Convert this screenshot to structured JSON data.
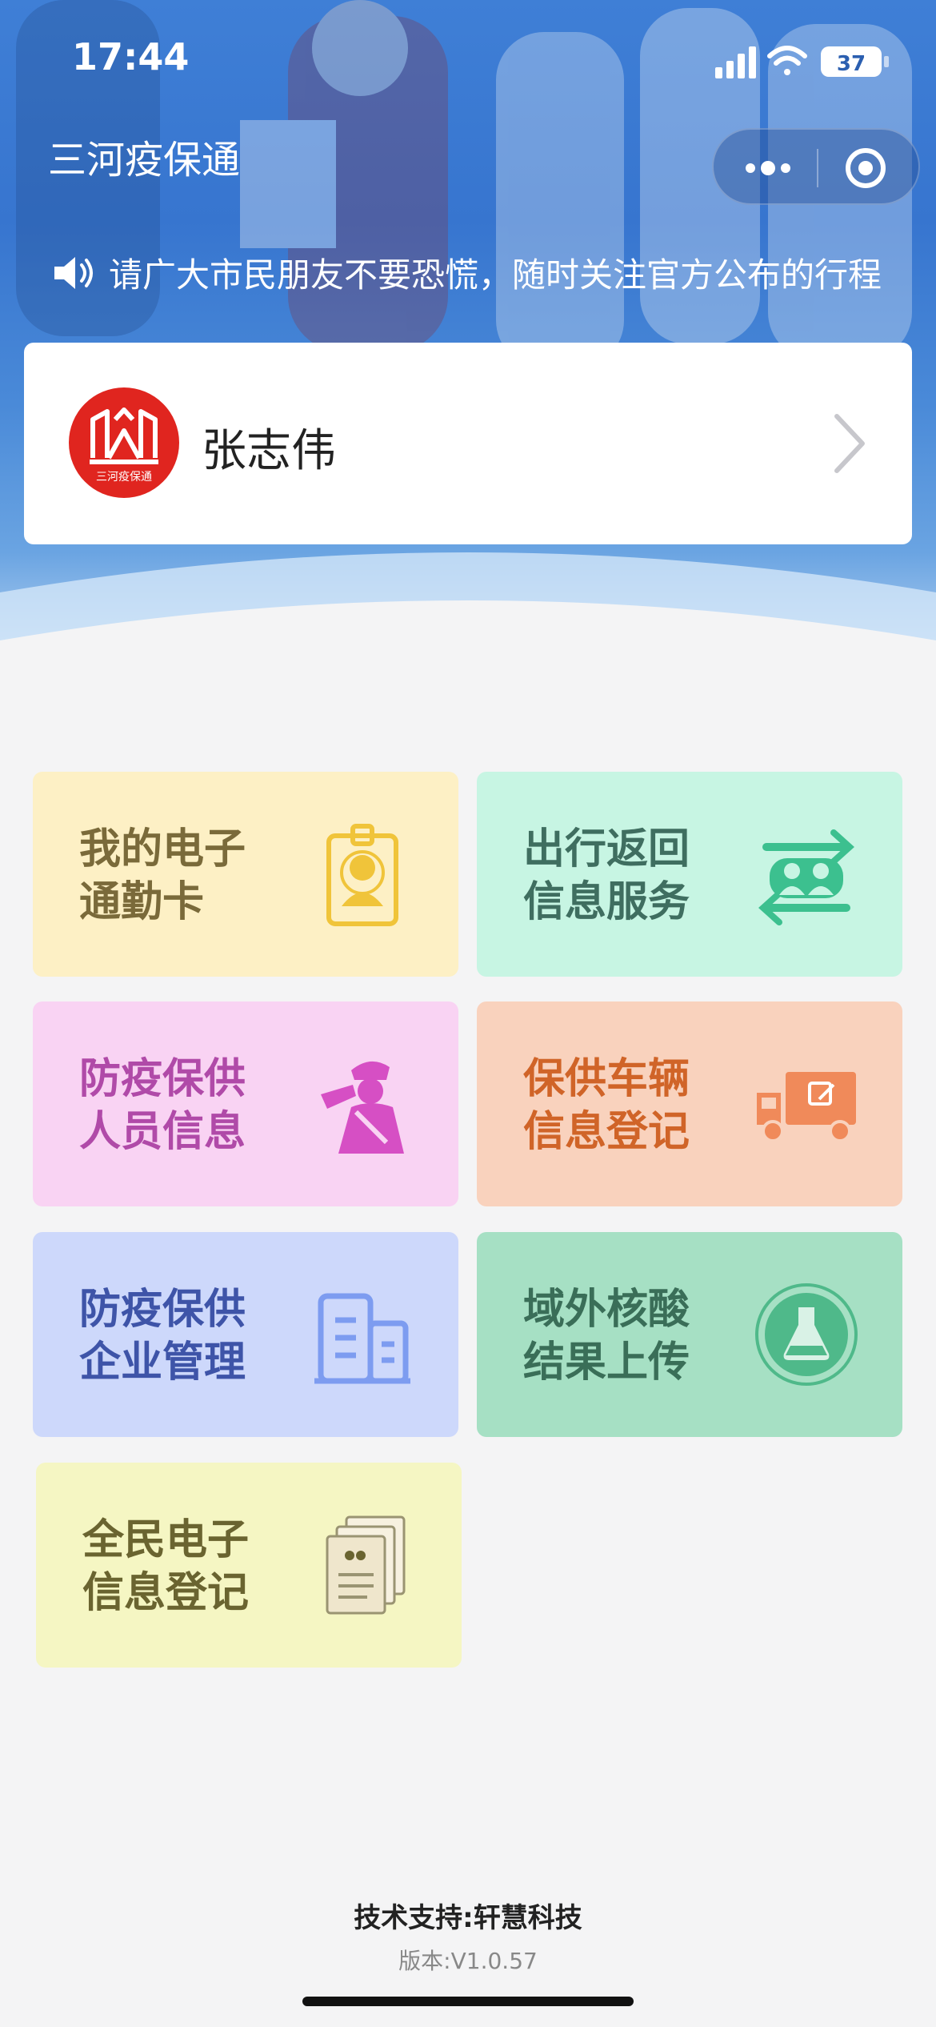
{
  "status_bar": {
    "time": "17:44",
    "battery": "37"
  },
  "header": {
    "app_title": "三河疫保通"
  },
  "notice": {
    "text": "请广大市民朋友不要恐慌，随时关注官方公布的行程"
  },
  "profile": {
    "name": "张志伟",
    "logo_text": "三河疫保通"
  },
  "tiles": [
    {
      "line1": "我的电子",
      "line2": "通勤卡",
      "icon": "badge-icon",
      "color": "#7a6a3a",
      "accent": "#f0c43a"
    },
    {
      "line1": "出行返回",
      "line2": "信息服务",
      "icon": "travel-return-icon",
      "color": "#3f6e60",
      "accent": "#3cc08f"
    },
    {
      "line1": "防疫保供",
      "line2": "人员信息",
      "icon": "staff-salute-icon",
      "color": "#b04aa8",
      "accent": "#d64fc4"
    },
    {
      "line1": "保供车辆",
      "line2": "信息登记",
      "icon": "truck-icon",
      "color": "#d06428",
      "accent": "#f08a5a"
    },
    {
      "line1": "防疫保供",
      "line2": "企业管理",
      "icon": "building-icon",
      "color": "#3e54a8",
      "accent": "#7d9cf0"
    },
    {
      "line1": "域外核酸",
      "line2": "结果上传",
      "icon": "flask-icon",
      "color": "#3a6e58",
      "accent": "#4fb98a"
    },
    {
      "line1": "全民电子",
      "line2": "信息登记",
      "icon": "documents-icon",
      "color": "#6a6430",
      "accent": "#9a9472"
    }
  ],
  "footer": {
    "support": "技术支持:轩慧科技",
    "version": "版本:V1.0.57"
  }
}
